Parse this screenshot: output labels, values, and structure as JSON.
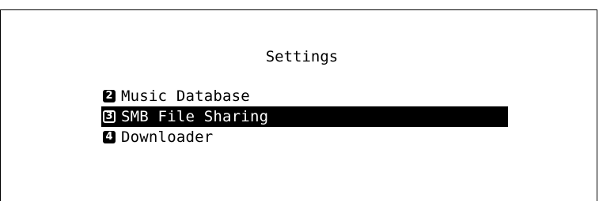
{
  "screen": {
    "title": "Settings"
  },
  "menu": {
    "items": [
      {
        "number": "2",
        "label": "Music Database",
        "selected": false
      },
      {
        "number": "3",
        "label": "SMB File Sharing",
        "selected": true
      },
      {
        "number": "4",
        "label": "Downloader",
        "selected": false
      }
    ]
  },
  "colors": {
    "background": "#ffffff",
    "text": "#000000",
    "highlight_bg": "#000000",
    "highlight_text": "#ffffff"
  }
}
